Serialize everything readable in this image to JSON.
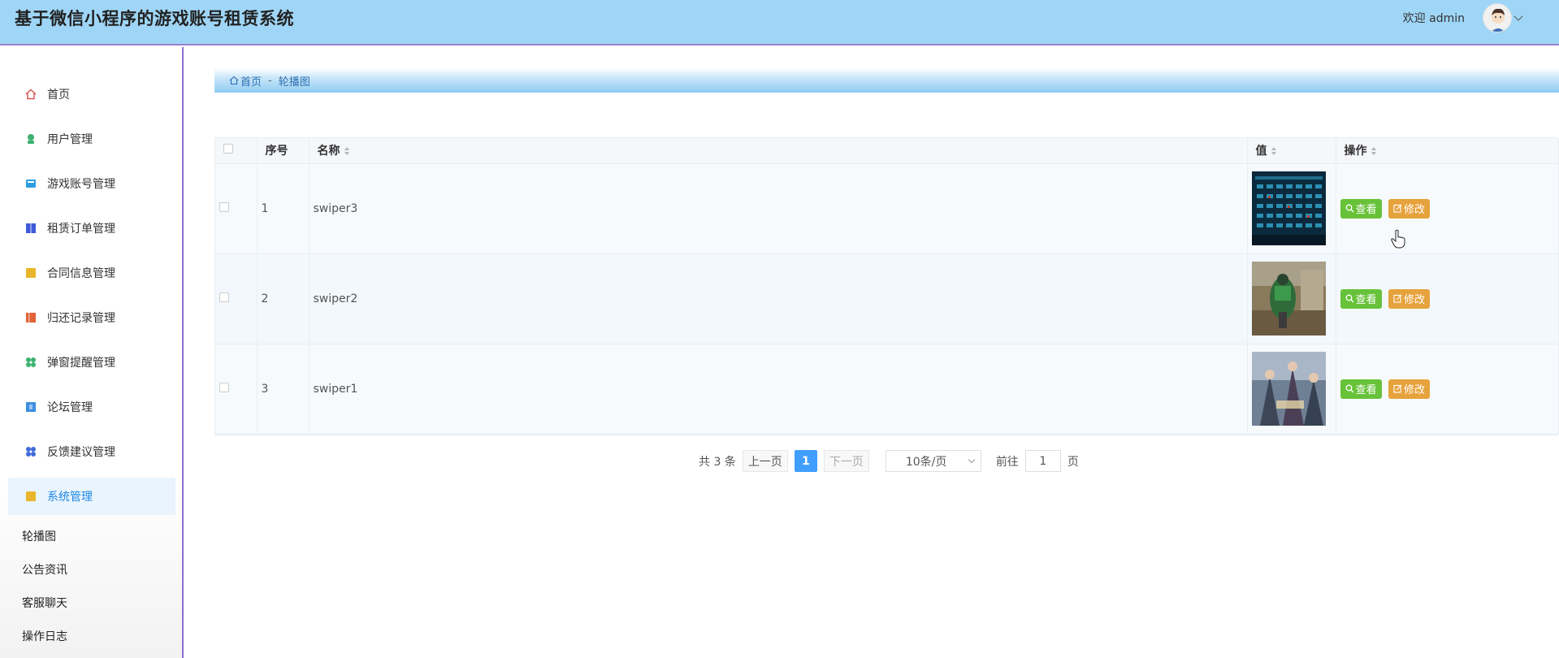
{
  "header": {
    "title": "基于微信小程序的游戏账号租赁系统",
    "welcome": "欢迎 admin"
  },
  "sidebar": {
    "items": [
      {
        "label": "首页",
        "icon": "home-icon",
        "color": "#d9534f"
      },
      {
        "label": "用户管理",
        "icon": "user-icon",
        "color": "#3cb371"
      },
      {
        "label": "游戏账号管理",
        "icon": "game-account-icon",
        "color": "#2b9fe0"
      },
      {
        "label": "租赁订单管理",
        "icon": "order-icon",
        "color": "#3f5bd9"
      },
      {
        "label": "合同信息管理",
        "icon": "contract-icon",
        "color": "#e8b52b"
      },
      {
        "label": "归还记录管理",
        "icon": "return-record-icon",
        "color": "#e0633a"
      },
      {
        "label": "弹窗提醒管理",
        "icon": "popup-icon",
        "color": "#3cb371"
      },
      {
        "label": "论坛管理",
        "icon": "forum-icon",
        "color": "#3d8fe0"
      },
      {
        "label": "反馈建议管理",
        "icon": "feedback-icon",
        "color": "#3f6bd9"
      },
      {
        "label": "系统管理",
        "icon": "system-icon",
        "color": "#e8b52b",
        "active": true
      }
    ],
    "sub_items": [
      "轮播图",
      "公告资讯",
      "客服聊天",
      "操作日志"
    ]
  },
  "breadcrumb": {
    "home": "首页",
    "current": "轮播图"
  },
  "table": {
    "columns": [
      "序号",
      "名称",
      "值",
      "操作"
    ],
    "rows": [
      {
        "index": "1",
        "name": "swiper3"
      },
      {
        "index": "2",
        "name": "swiper2"
      },
      {
        "index": "3",
        "name": "swiper1"
      }
    ],
    "view_label": "查看",
    "edit_label": "修改"
  },
  "pagination": {
    "total": "共 3 条",
    "prev": "上一页",
    "current_page": "1",
    "next": "下一页",
    "page_size": "10条/页",
    "goto": "前往",
    "goto_value": "1",
    "page_unit": "页"
  }
}
